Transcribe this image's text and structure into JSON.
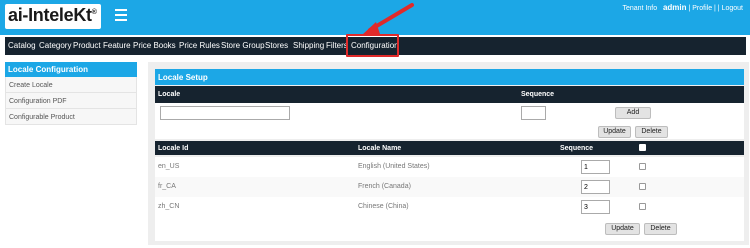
{
  "brand": {
    "logo_text": "ai-InteleKt",
    "logo_sup": "®"
  },
  "header": {
    "tenant_info": "Tenant Info",
    "user": "admin",
    "profile": "Profile",
    "logout": "Logout"
  },
  "nav": {
    "items": [
      {
        "label": "Catalog"
      },
      {
        "label": "Category"
      },
      {
        "label": "Product"
      },
      {
        "label": "Feature"
      },
      {
        "label": "Price Books"
      },
      {
        "label": "Price Rules"
      },
      {
        "label": "Store Group"
      },
      {
        "label": "Stores"
      },
      {
        "label": "Shipping"
      },
      {
        "label": "Filters"
      },
      {
        "label": "Configuration"
      }
    ],
    "active": "Configuration"
  },
  "sidebar": {
    "title": "Locale  Configuration",
    "items": [
      {
        "label": "Create Locale"
      },
      {
        "label": "Configuration PDF"
      },
      {
        "label": "Configurable Product"
      }
    ]
  },
  "setup": {
    "title": "Locale  Setup",
    "form": {
      "locale_header": "Locale",
      "sequence_header": "Sequence",
      "locale_value": "",
      "sequence_value": "",
      "add_label": "Add",
      "update_label": "Update",
      "delete_label": "Delete"
    },
    "table": {
      "headers": {
        "locale_id": "Locale Id",
        "locale_name": "Locale Name",
        "sequence": "Sequence"
      },
      "rows": [
        {
          "id": "en_US",
          "name": "English (United States)",
          "sequence": "1"
        },
        {
          "id": "fr_CA",
          "name": "French (Canada)",
          "sequence": "2"
        },
        {
          "id": "zh_CN",
          "name": "Chinese (China)",
          "sequence": "3"
        }
      ],
      "update_label": "Update",
      "delete_label": "Delete"
    }
  },
  "colors": {
    "accent": "#1ca7e6",
    "dark": "#16232f",
    "highlight": "#e02a2a"
  }
}
